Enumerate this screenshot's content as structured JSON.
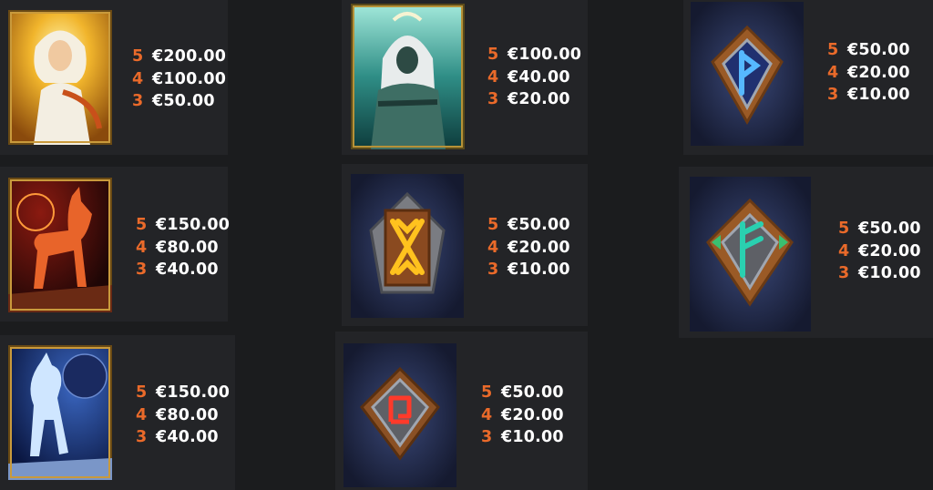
{
  "symbols": [
    {
      "name": "sun-goddess",
      "icon": "sun-goddess-icon",
      "payouts": [
        {
          "count": "5",
          "amount": "€200.00"
        },
        {
          "count": "4",
          "amount": "€100.00"
        },
        {
          "count": "3",
          "amount": "€50.00"
        }
      ]
    },
    {
      "name": "hooded-sorcerer",
      "icon": "hooded-sorcerer-icon",
      "payouts": [
        {
          "count": "5",
          "amount": "€100.00"
        },
        {
          "count": "4",
          "amount": "€40.00"
        },
        {
          "count": "3",
          "amount": "€20.00"
        }
      ]
    },
    {
      "name": "rune-wunjo-blue",
      "icon": "blue-rune-icon",
      "payouts": [
        {
          "count": "5",
          "amount": "€50.00"
        },
        {
          "count": "4",
          "amount": "€20.00"
        },
        {
          "count": "3",
          "amount": "€10.00"
        }
      ]
    },
    {
      "name": "fire-wolf",
      "icon": "fire-wolf-icon",
      "payouts": [
        {
          "count": "5",
          "amount": "€150.00"
        },
        {
          "count": "4",
          "amount": "€80.00"
        },
        {
          "count": "3",
          "amount": "€40.00"
        }
      ]
    },
    {
      "name": "rune-othala-gold",
      "icon": "gold-rune-icon",
      "payouts": [
        {
          "count": "5",
          "amount": "€50.00"
        },
        {
          "count": "4",
          "amount": "€20.00"
        },
        {
          "count": "3",
          "amount": "€10.00"
        }
      ]
    },
    {
      "name": "rune-fehu-green",
      "icon": "green-rune-icon",
      "payouts": [
        {
          "count": "5",
          "amount": "€50.00"
        },
        {
          "count": "4",
          "amount": "€20.00"
        },
        {
          "count": "3",
          "amount": "€10.00"
        }
      ]
    },
    {
      "name": "ice-wolf",
      "icon": "ice-wolf-icon",
      "payouts": [
        {
          "count": "5",
          "amount": "€150.00"
        },
        {
          "count": "4",
          "amount": "€80.00"
        },
        {
          "count": "3",
          "amount": "€40.00"
        }
      ]
    },
    {
      "name": "rune-spiral-red",
      "icon": "red-rune-icon",
      "payouts": [
        {
          "count": "5",
          "amount": "€50.00"
        },
        {
          "count": "4",
          "amount": "€20.00"
        },
        {
          "count": "3",
          "amount": "€10.00"
        }
      ]
    }
  ],
  "colors": {
    "background": "#1b1c1e",
    "panel": "#232427",
    "count": "#ea6a2a",
    "amount": "#ffffff"
  }
}
